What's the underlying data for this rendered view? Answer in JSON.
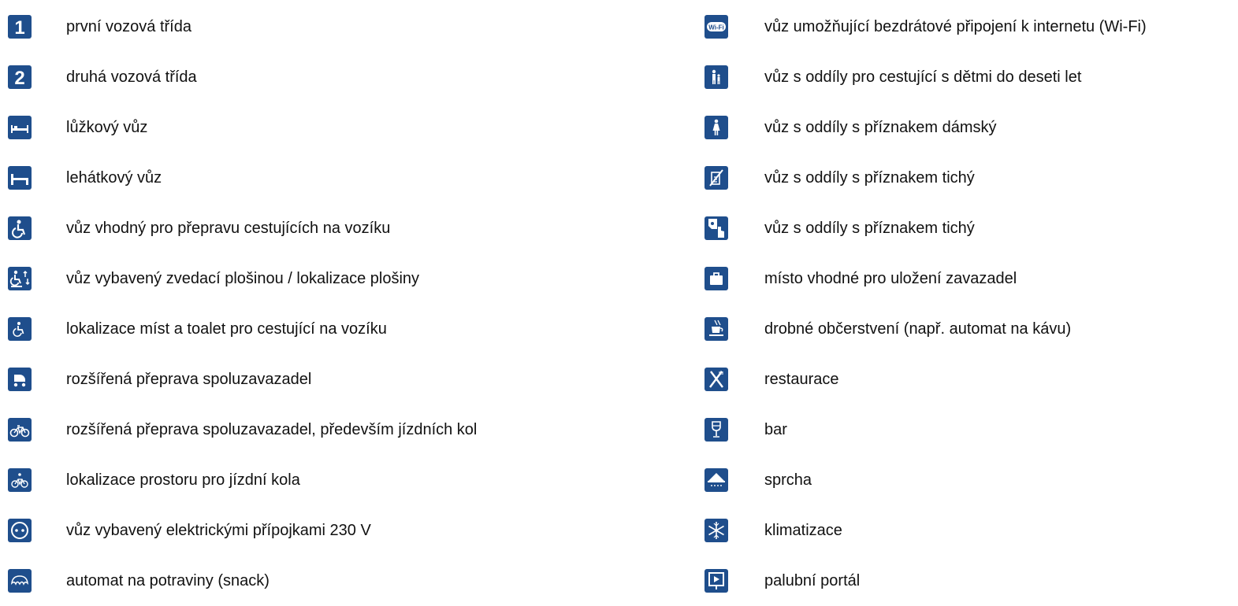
{
  "left_items": [
    {
      "icon": "first-class-icon",
      "label": "první vozová třída"
    },
    {
      "icon": "second-class-icon",
      "label": "druhá vozová třída"
    },
    {
      "icon": "sleeping-car-icon",
      "label": "lůžkový vůz"
    },
    {
      "icon": "couchette-car-icon",
      "label": "lehátkový vůz"
    },
    {
      "icon": "wheelchair-icon",
      "label": "vůz vhodný pro přepravu cestujících na vozíku"
    },
    {
      "icon": "wheelchair-lift-icon",
      "label": "vůz vybavený zvedací plošinou / lokalizace plošiny"
    },
    {
      "icon": "wheelchair-location-icon",
      "label": "lokalizace míst a toalet pro cestující na vozíku"
    },
    {
      "icon": "pram-icon",
      "label": "rozšířená přeprava spoluzavazadel"
    },
    {
      "icon": "bicycle-icon",
      "label": "rozšířená přeprava spoluzavazadel, především jízdních kol"
    },
    {
      "icon": "bicycle-location-icon",
      "label": "lokalizace prostoru pro jízdní kola"
    },
    {
      "icon": "power-socket-icon",
      "label": "vůz vybavený elektrickými přípojkami 230 V"
    },
    {
      "icon": "croissant-icon",
      "label": "automat na potraviny (snack)"
    }
  ],
  "right_items": [
    {
      "icon": "wifi-icon",
      "label": "vůz umožňující bezdrátové připojení k internetu (Wi-Fi)"
    },
    {
      "icon": "family-compartment-icon",
      "label": "vůz s oddíly pro cestující s dětmi do deseti let"
    },
    {
      "icon": "ladies-compartment-icon",
      "label": "vůz s oddíly s příznakem dámský"
    },
    {
      "icon": "quiet-compartment-icon",
      "label": "vůz s oddíly s příznakem tichý"
    },
    {
      "icon": "quiet-zone-icon",
      "label": "vůz s oddíly s příznakem tichý"
    },
    {
      "icon": "luggage-icon",
      "label": "místo vhodné pro uložení zavazadel"
    },
    {
      "icon": "coffee-icon",
      "label": "drobné občerstvení (např. automat na kávu)"
    },
    {
      "icon": "restaurant-icon",
      "label": "restaurace"
    },
    {
      "icon": "bar-icon",
      "label": "bar"
    },
    {
      "icon": "shower-icon",
      "label": "sprcha"
    },
    {
      "icon": "air-conditioning-icon",
      "label": "klimatizace"
    },
    {
      "icon": "onboard-portal-icon",
      "label": "palubní portál"
    }
  ],
  "icon_glyphs": {
    "first_class": "1",
    "second_class": "2",
    "wifi": "Wi-Fi"
  },
  "colors": {
    "icon_background": "#1f4e8c",
    "icon_foreground": "#ffffff"
  }
}
